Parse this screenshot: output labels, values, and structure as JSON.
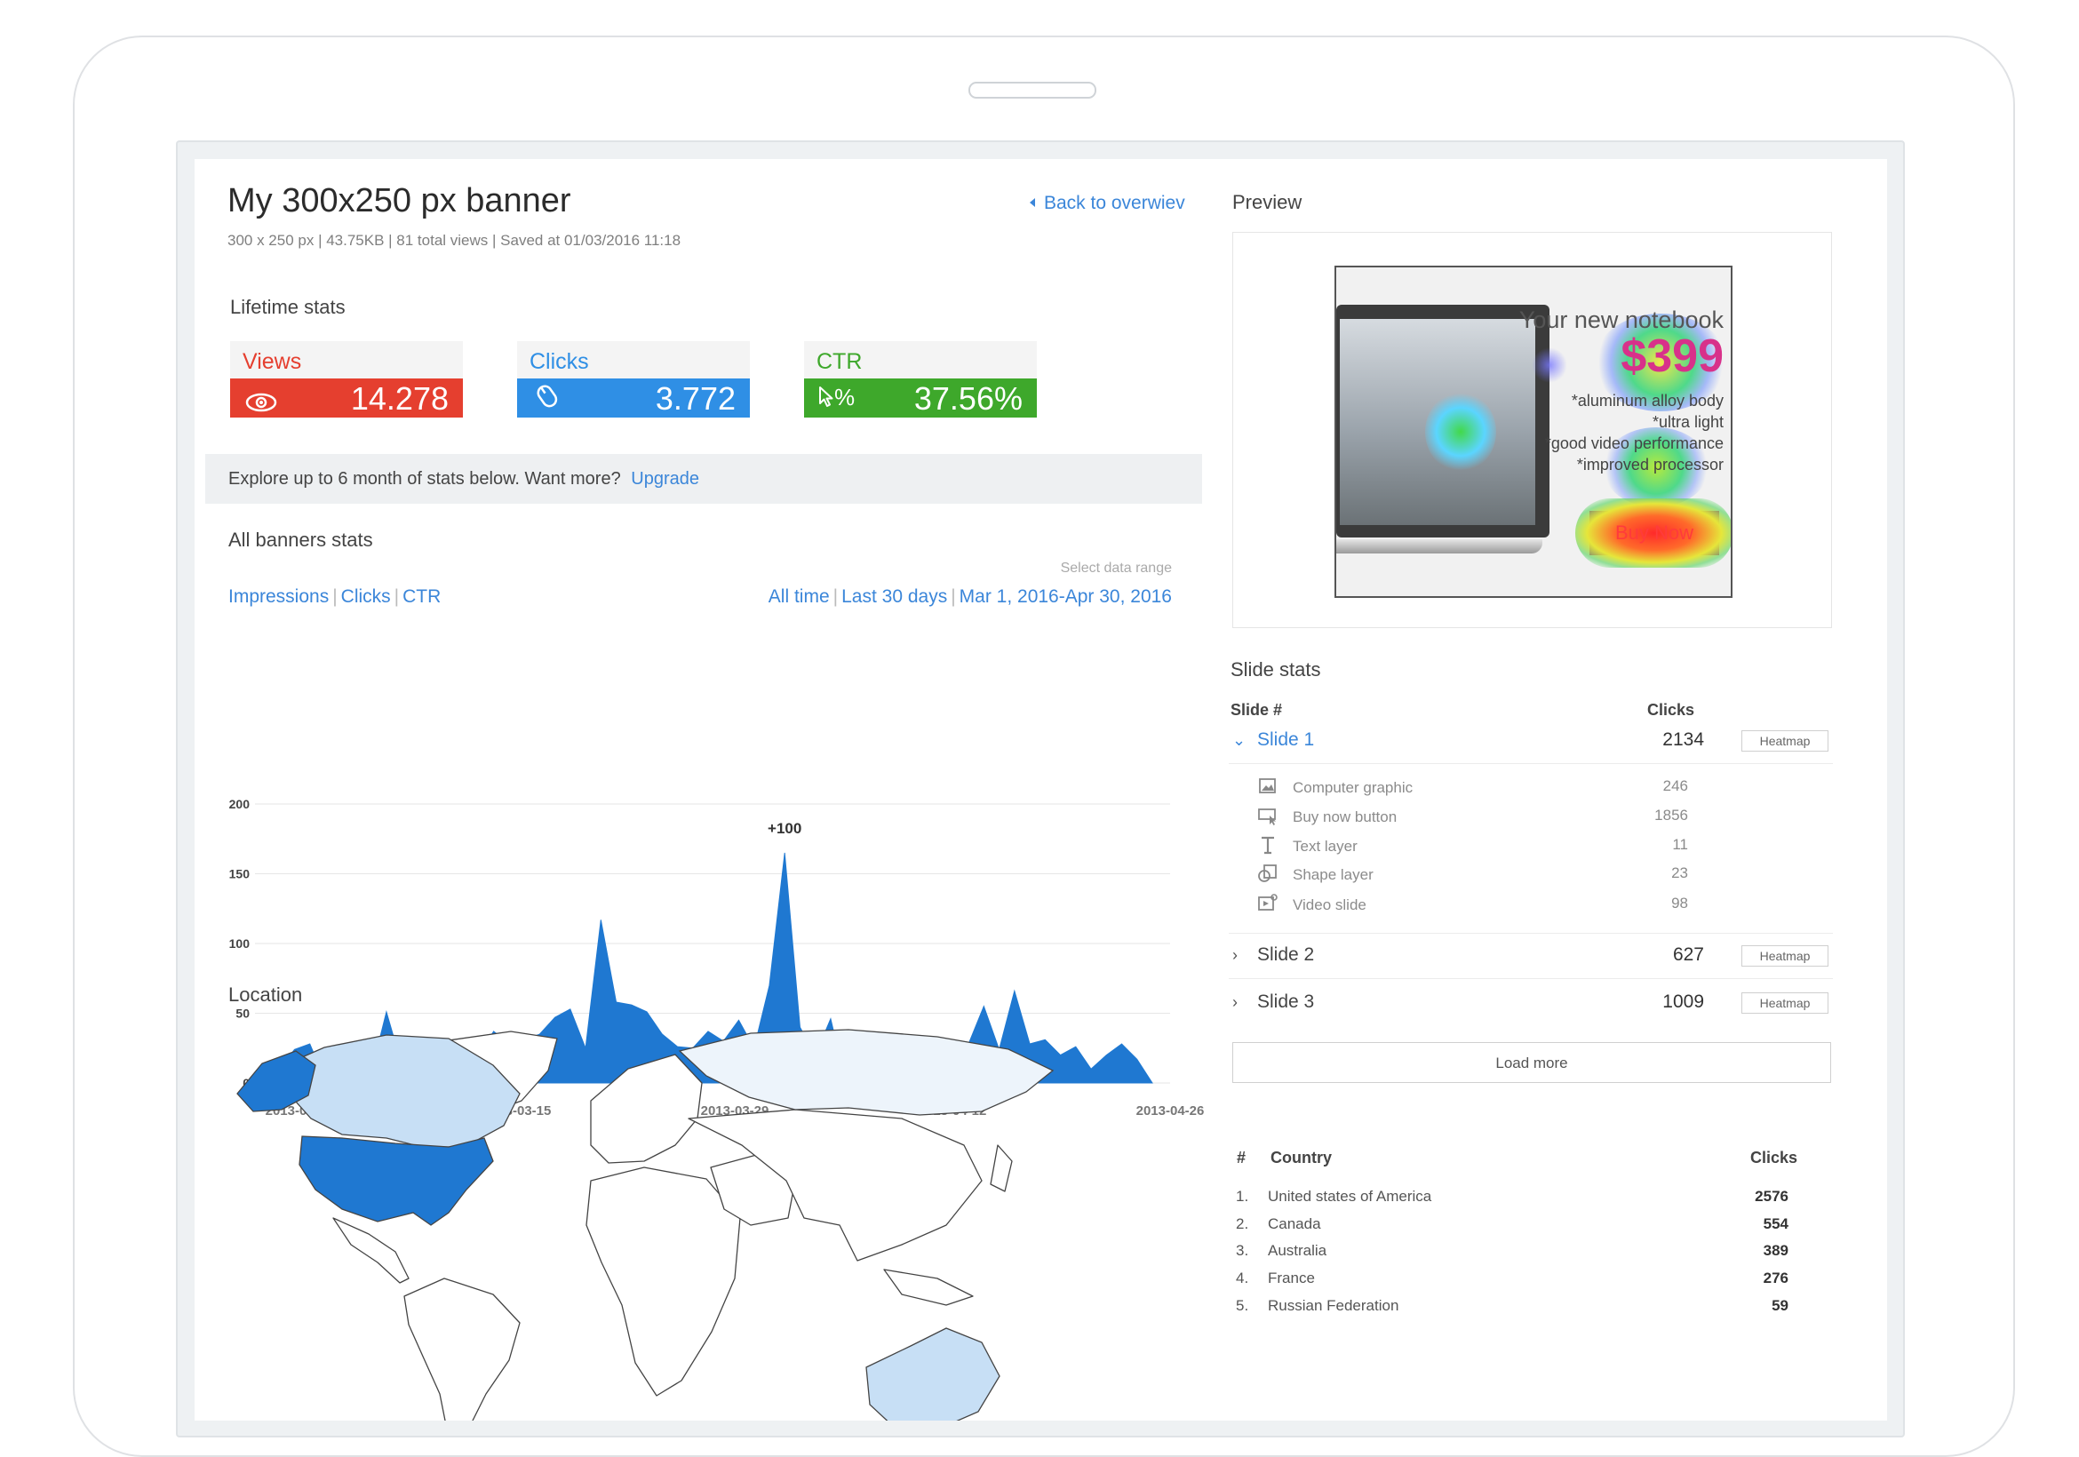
{
  "page": {
    "title": "My 300x250 px banner",
    "meta": "300 x 250 px  |  43.75KB  |  81 total views  |  Saved at 01/03/2016 11:18",
    "back_link": "Back to overwiev"
  },
  "lifetime": {
    "heading": "Lifetime stats",
    "cards": [
      {
        "label": "Views",
        "value": "14.278",
        "color": "#e53f2f",
        "label_color": "#e53f2f",
        "icon": "eye-icon"
      },
      {
        "label": "Clicks",
        "value": "3.772",
        "color": "#2f8fe5",
        "label_color": "#2f8fe5",
        "icon": "mouse-icon"
      },
      {
        "label": "CTR",
        "value": "37.56%",
        "color": "#3ea82b",
        "label_color": "#3ea82b",
        "icon": "cursor-percent-icon",
        "icon_text": "%"
      }
    ]
  },
  "upgrade": {
    "text": "Explore up to 6 month of stats below. Want more?",
    "link": "Upgrade"
  },
  "all_stats": {
    "heading": "All banners stats",
    "metric_tabs": [
      "Impressions",
      "Clicks",
      "CTR"
    ],
    "range_label": "Select data range",
    "range_tabs": [
      "All time",
      "Last 30 days",
      "Mar 1, 2016-Apr 30, 2016"
    ]
  },
  "chart_data": {
    "type": "area",
    "title": "",
    "xlabel": "",
    "ylabel": "",
    "ylim": [
      0,
      200
    ],
    "yticks": [
      "200",
      "150",
      "100",
      "50",
      "0"
    ],
    "xticks": [
      "2013-03-01",
      "2013-03-15",
      "2013-03-29",
      "2013-04-12",
      "2013-04-26"
    ],
    "grid": true,
    "color": "#1f78d1",
    "x": [
      "2013-03-01",
      "2013-03-02",
      "2013-03-03",
      "2013-03-04",
      "2013-03-05",
      "2013-03-06",
      "2013-03-07",
      "2013-03-08",
      "2013-03-09",
      "2013-03-10",
      "2013-03-11",
      "2013-03-12",
      "2013-03-13",
      "2013-03-14",
      "2013-03-15",
      "2013-03-16",
      "2013-03-17",
      "2013-03-18",
      "2013-03-19",
      "2013-03-20",
      "2013-03-21",
      "2013-03-22",
      "2013-03-23",
      "2013-03-24",
      "2013-03-25",
      "2013-03-26",
      "2013-03-27",
      "2013-03-28",
      "2013-03-29",
      "2013-03-30",
      "2013-03-31",
      "2013-04-01",
      "2013-04-02",
      "2013-04-03",
      "2013-04-04",
      "2013-04-05",
      "2013-04-06",
      "2013-04-07",
      "2013-04-08",
      "2013-04-09",
      "2013-04-10",
      "2013-04-11",
      "2013-04-12",
      "2013-04-13",
      "2013-04-14",
      "2013-04-15",
      "2013-04-16",
      "2013-04-17",
      "2013-04-18",
      "2013-04-19",
      "2013-04-20",
      "2013-04-21",
      "2013-04-22",
      "2013-04-23",
      "2013-04-24",
      "2013-04-25",
      "2013-04-26"
    ],
    "values": [
      14,
      10,
      24,
      28,
      2,
      8,
      8,
      7,
      51,
      13,
      18,
      10,
      15,
      18,
      20,
      37,
      28,
      31,
      35,
      47,
      53,
      25,
      117,
      58,
      56,
      51,
      35,
      26,
      25,
      37,
      30,
      45,
      25,
      70,
      165,
      40,
      20,
      46,
      0,
      25,
      20,
      18,
      17,
      14,
      23,
      12,
      28,
      55,
      24,
      66,
      28,
      31,
      20,
      26,
      10,
      20,
      28,
      17,
      0
    ],
    "annotation": "+100"
  },
  "location": {
    "heading": "Location"
  },
  "preview": {
    "heading": "Preview",
    "banner_title": "Your new notebook",
    "banner_price": "$399",
    "banner_features": [
      "*aluminum alloy body",
      "*ultra light",
      "*good video performance",
      "*improved processor"
    ],
    "banner_button": "Buy Now"
  },
  "slide_stats": {
    "heading": "Slide stats",
    "col_slide": "Slide #",
    "col_clicks": "Clicks",
    "heatmap_label": "Heatmap",
    "slides": [
      {
        "name": "Slide 1",
        "clicks": "2134",
        "expanded": true
      },
      {
        "name": "Slide 2",
        "clicks": "627",
        "expanded": false
      },
      {
        "name": "Slide 3",
        "clicks": "1009",
        "expanded": false
      }
    ],
    "layers": [
      {
        "name": "Computer graphic",
        "clicks": "246",
        "icon": "image-icon"
      },
      {
        "name": "Buy now button",
        "clicks": "1856",
        "icon": "button-cursor-icon"
      },
      {
        "name": "Text layer",
        "clicks": "11",
        "icon": "text-icon"
      },
      {
        "name": "Shape layer",
        "clicks": "23",
        "icon": "shape-icon"
      },
      {
        "name": "Video slide",
        "clicks": "98",
        "icon": "video-icon"
      }
    ],
    "load_more": "Load more"
  },
  "countries": {
    "col_index": "#",
    "col_country": "Country",
    "col_clicks": "Clicks",
    "rows": [
      {
        "idx": "1.",
        "name": "United states of America",
        "clicks": "2576"
      },
      {
        "idx": "2.",
        "name": "Canada",
        "clicks": "554"
      },
      {
        "idx": "3.",
        "name": "Australia",
        "clicks": "389"
      },
      {
        "idx": "4.",
        "name": "France",
        "clicks": "276"
      },
      {
        "idx": "5.",
        "name": "Russian Federation",
        "clicks": "59"
      }
    ]
  }
}
